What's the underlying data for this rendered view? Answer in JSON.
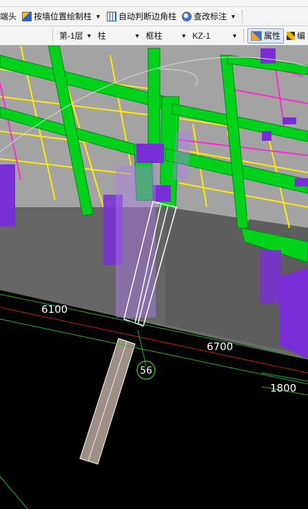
{
  "toolbar1": {
    "item_partial": "端头",
    "wall_column": "按墙位置绘制柱",
    "auto_corner": "自动判断边角柱",
    "check_annotation": "查改标注"
  },
  "toolbar2": {
    "floor": "第-1层",
    "category": "柱",
    "type": "框柱",
    "element": "KZ-1",
    "properties_button": "属性",
    "edit_partial": "编"
  },
  "scene": {
    "dimensions": [
      "6100",
      "6700",
      "1800"
    ],
    "axis_label": "56"
  },
  "colors": {
    "slab": "#9a9a9a",
    "beam": "#00d11b",
    "column": "#7a2fd6",
    "rebar_yellow": "#ffea00",
    "rebar_magenta": "#ff2bd6",
    "selected_column_outline": "#ffffff",
    "axis_line": "#22b822",
    "axis_red": "#cc1c1c"
  }
}
